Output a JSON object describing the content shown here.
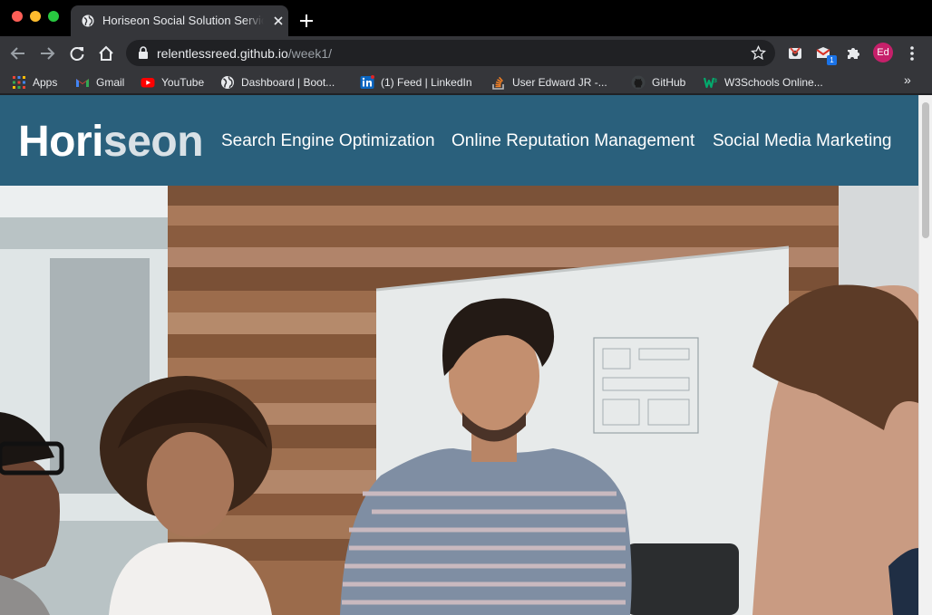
{
  "browser": {
    "tab_title": "Horiseon Social Solution Services",
    "url_host": "relentlessreed.github.io",
    "url_path": "/week1/",
    "profile_initials": "Ed",
    "extension_badge": "1"
  },
  "bookmarks": [
    {
      "label": "Apps",
      "icon": "apps-grid-icon"
    },
    {
      "label": "Gmail",
      "icon": "gmail-icon"
    },
    {
      "label": "YouTube",
      "icon": "youtube-icon"
    },
    {
      "label": "Dashboard | Boot...",
      "icon": "globe-icon"
    },
    {
      "label": "(1) Feed | LinkedIn",
      "icon": "linkedin-icon"
    },
    {
      "label": "User Edward JR -...",
      "icon": "stackoverflow-icon"
    },
    {
      "label": "GitHub",
      "icon": "github-icon"
    },
    {
      "label": "W3Schools Online...",
      "icon": "w3schools-icon"
    }
  ],
  "site": {
    "logo_main": "Hori",
    "logo_accent": "seon",
    "nav": [
      {
        "label": "Search Engine Optimization"
      },
      {
        "label": "Online Reputation Management"
      },
      {
        "label": "Social Media Marketing"
      }
    ]
  },
  "colors": {
    "header_bg": "#2a607c",
    "logo_accent": "#d9e1e6",
    "browser_frame": "#35363a"
  }
}
